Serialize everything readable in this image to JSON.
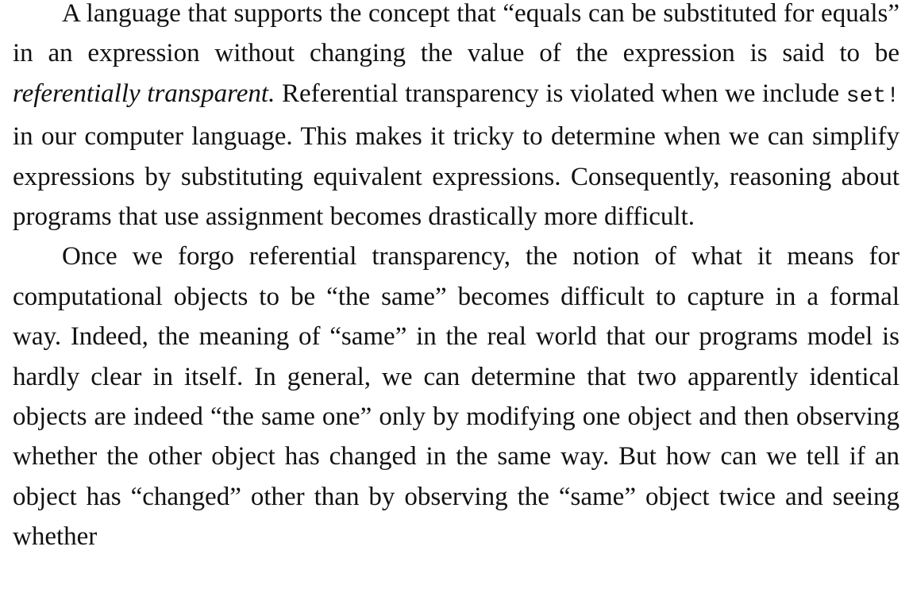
{
  "paragraphs": [
    {
      "before_term": "A language that supports the concept that “equals can be substituted for equals” in an expression without changing the value of the expres­sion is said to be ",
      "term": "referentially transparent.",
      "after_term_before_code": " Referential transparency is violated when we include ",
      "code": "set!",
      "after_code": " in our computer language. This makes it tricky to determine when we can simplify expressions by substituting equivalent expressions. Consequently, reasoning about programs that use assignment becomes drastically more difficult."
    },
    {
      "text": "Once we forgo referential transparency, the notion of what it means for computational objects to be “the same” becomes difficult to capture in a formal way. Indeed, the meaning of “same” in the real world that our programs model is hardly clear in itself. In general, we can determine that two apparently identical objects are indeed “the same one” only by modifying one object and then observing whether the other object has changed in the same way. But how can we tell if an object has “changed” other than by observing the “same” object twice and seeing whether"
    }
  ]
}
